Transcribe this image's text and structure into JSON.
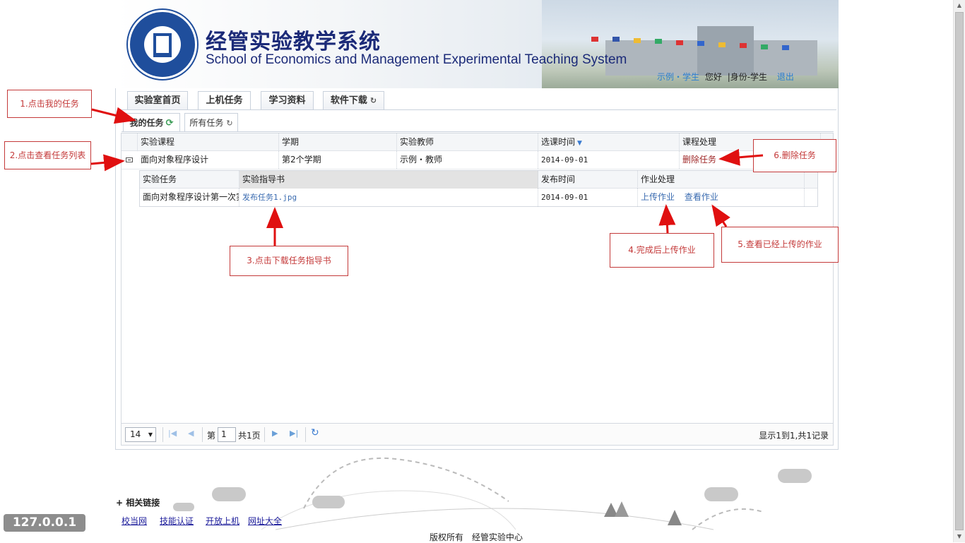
{
  "header": {
    "title_cn": "经管实验教学系统",
    "title_en": "School of Economics and Management Experimental Teaching System",
    "user_link": "示例・学生",
    "greeting": "您好",
    "role": "|身份-学生",
    "logout": "退出"
  },
  "main_tabs": [
    {
      "label": "实验室首页"
    },
    {
      "label": "上机任务"
    },
    {
      "label": "学习资料"
    },
    {
      "label": "软件下载"
    }
  ],
  "sub_tabs": [
    {
      "label": "我的任务"
    },
    {
      "label": "所有任务"
    }
  ],
  "grid": {
    "columns": [
      "实验课程",
      "学期",
      "实验教师",
      "选课时间",
      "课程处理"
    ],
    "rows": [
      {
        "course": "面向对象程序设计",
        "term": "第2个学期",
        "teacher": "示例・教师",
        "date": "2014-09-01",
        "action": "删除任务"
      }
    ]
  },
  "subgrid": {
    "columns": [
      "实验任务",
      "实验指导书",
      "发布时间",
      "作业处理"
    ],
    "rows": [
      {
        "task": "面向对象程序设计第一次实验",
        "guide": "发布任务1.jpg",
        "date": "2014-09-01",
        "upload": "上传作业",
        "view": "查看作业"
      }
    ]
  },
  "pager": {
    "page_size": "14",
    "page_prefix": "第",
    "page_number": "1",
    "page_total": "共1页",
    "info": "显示1到1,共1记录"
  },
  "annotations": {
    "a1": "1.点击我的任务",
    "a2": "2.点击查看任务列表",
    "a3": "3.点击下载任务指导书",
    "a4": "4.完成后上传作业",
    "a5": "5.查看已经上传的作业",
    "a6": "6.删除任务"
  },
  "footer": {
    "links_title": "+ 相关链接",
    "links": [
      "校当网",
      "技能认证",
      "开放上机",
      "网址大全"
    ],
    "copyright": "版权所有　经管实验中心"
  },
  "ip_badge": "127.0.0.1",
  "colors": {
    "title": "#1b2a78",
    "link": "#2a7ed0",
    "annotation": "#c43a3a",
    "delete": "#a02a2a"
  }
}
